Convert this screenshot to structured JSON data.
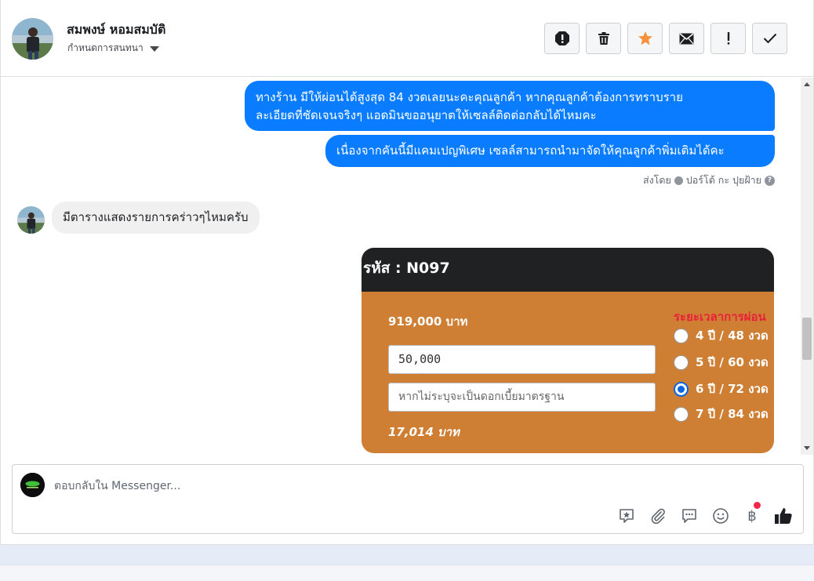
{
  "header": {
    "contact_name": "สมพงษ์ หอมสมบัติ",
    "assign_label": "กำหนดการสนทนา",
    "actions": [
      {
        "name": "spam-icon",
        "label": "Report spam"
      },
      {
        "name": "trash-icon",
        "label": "Delete"
      },
      {
        "name": "star-icon",
        "label": "Star"
      },
      {
        "name": "mail-icon",
        "label": "Mark unread"
      },
      {
        "name": "follow-up-icon",
        "label": "!"
      },
      {
        "name": "check-icon",
        "label": "Done"
      }
    ],
    "colors": {
      "star": "#f7923b"
    }
  },
  "conversation": {
    "outgoing_1": [
      "ทางร้าน มีให้ผ่อนได้สูงสุด 84 งวดเลยนะคะคุณลูกค้า  หากคุณลูกค้าต้องการทราบราย",
      "ละเอียดที่ชัดเจนจริงๆ แอดมินขออนุยาตให้เซลล์ติดต่อกลับได้ไหมคะ"
    ],
    "outgoing_2": "เนื่องจากคันนี้มีแคมเปญพิเศษ เซลล์สามารถนำมาจัดให้คุณลูกค้าพิ่มเติมได้คะ",
    "sent_by_prefix": "ส่งโดย",
    "sent_by_name": "ปอร์โต้ กะ ปุยฝ้าย",
    "incoming": "มีตารางแสดงรายการคร่าวๆไหมครับ",
    "colors": {
      "outgoing_bubble": "#0a7cff",
      "incoming_bubble": "#f0f0f0"
    }
  },
  "card": {
    "code": "รหัส : N097",
    "price": "919,000 บาท",
    "down_payment": "50,000",
    "interest_placeholder": "หากไม่ระบุจะเป็นดอกเบี้ยมาตรฐาน",
    "monthly": "17,014 บาท",
    "period_title": "ระยะเวลาการผ่อน",
    "options": [
      {
        "label": "4 ปี / 48 งวด",
        "selected": false
      },
      {
        "label": "5 ปี / 60 งวด",
        "selected": false
      },
      {
        "label": "6 ปี / 72 งวด",
        "selected": true
      },
      {
        "label": "7 ปี / 84 งวด",
        "selected": false
      }
    ],
    "colors": {
      "header": "#1f2122",
      "body": "#cf7f33",
      "period_title": "#e8223a"
    }
  },
  "composer": {
    "placeholder": "ตอบกลับใน Messenger...",
    "tools": [
      "saved-reply-icon",
      "attachment-icon",
      "quick-reply-icon",
      "emoji-icon",
      "baht-icon",
      "like-icon"
    ],
    "baht_symbol": "฿"
  }
}
